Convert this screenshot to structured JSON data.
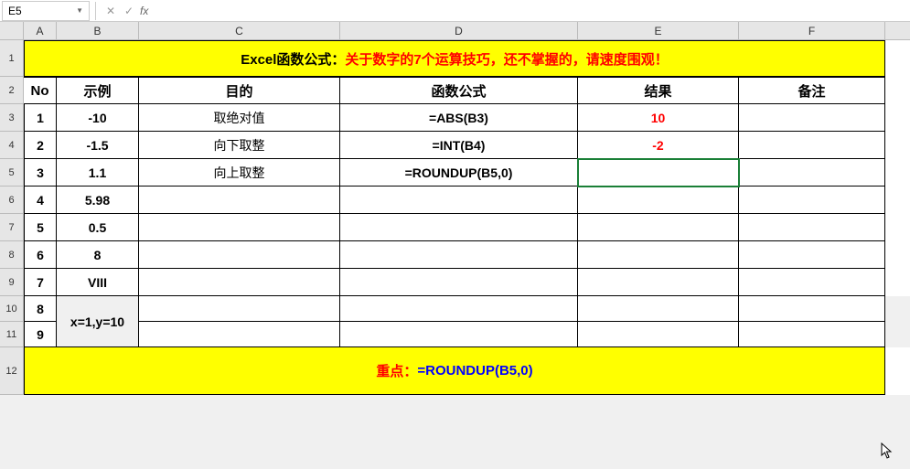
{
  "name_box": "E5",
  "formula_bar": "",
  "col_headers": [
    "A",
    "B",
    "C",
    "D",
    "E",
    "F"
  ],
  "row_headers": [
    "1",
    "2",
    "3",
    "4",
    "5",
    "6",
    "7",
    "8",
    "9",
    "10",
    "11",
    "12"
  ],
  "title": {
    "prefix": "Excel函数公式：",
    "body": "关于数字的7个运算技巧，还不掌握的，请速度围观！"
  },
  "headers": {
    "a": "No",
    "b": "示例",
    "c": "目的",
    "d": "函数公式",
    "e": "结果",
    "f": "备注"
  },
  "rows": [
    {
      "no": "1",
      "ex": "-10",
      "purpose": "取绝对值",
      "formula": "=ABS(B3)",
      "result": "10",
      "note": ""
    },
    {
      "no": "2",
      "ex": "-1.5",
      "purpose": "向下取整",
      "formula": "=INT(B4)",
      "result": "-2",
      "note": ""
    },
    {
      "no": "3",
      "ex": "1.1",
      "purpose": "向上取整",
      "formula": "=ROUNDUP(B5,0)",
      "result": "",
      "note": ""
    },
    {
      "no": "4",
      "ex": "5.98",
      "purpose": "",
      "formula": "",
      "result": "",
      "note": ""
    },
    {
      "no": "5",
      "ex": "0.5",
      "purpose": "",
      "formula": "",
      "result": "",
      "note": ""
    },
    {
      "no": "6",
      "ex": "8",
      "purpose": "",
      "formula": "",
      "result": "",
      "note": ""
    },
    {
      "no": "7",
      "ex": "VIII",
      "purpose": "",
      "formula": "",
      "result": "",
      "note": ""
    },
    {
      "no": "8",
      "ex": "x=1,y=10",
      "purpose": "",
      "formula": "",
      "result": "",
      "note": ""
    },
    {
      "no": "9",
      "ex": "",
      "purpose": "",
      "formula": "",
      "result": "",
      "note": ""
    }
  ],
  "footer": {
    "label": "重点：",
    "value": "=ROUNDUP(B5,0)"
  },
  "selected_cell": "E5"
}
